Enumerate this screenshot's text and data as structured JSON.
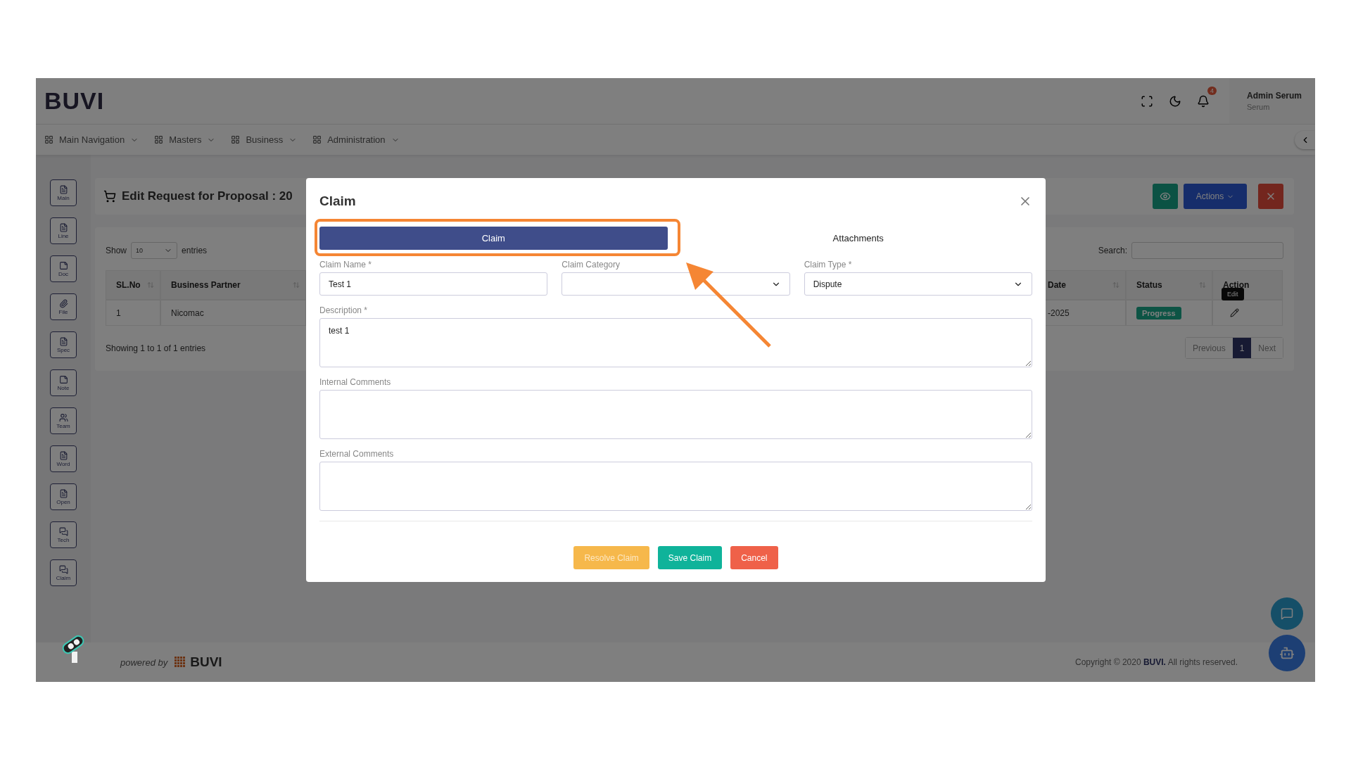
{
  "header": {
    "logo": "BUVI",
    "notification_count": "4",
    "user": {
      "name": "Admin Serum",
      "role": "Serum"
    }
  },
  "nav": [
    {
      "label": "Main Navigation"
    },
    {
      "label": "Masters"
    },
    {
      "label": "Business"
    },
    {
      "label": "Administration"
    }
  ],
  "sidebar": [
    {
      "label": "Main"
    },
    {
      "label": "Line"
    },
    {
      "label": "Doc"
    },
    {
      "label": "File"
    },
    {
      "label": "Spec"
    },
    {
      "label": "Note"
    },
    {
      "label": "Team"
    },
    {
      "label": "Word"
    },
    {
      "label": "Open"
    },
    {
      "label": "Tech"
    },
    {
      "label": "Claim"
    }
  ],
  "page_title": "Edit Request for Proposal : 20",
  "toolbar": {
    "actions_label": "Actions"
  },
  "table_controls": {
    "show_label": "Show",
    "page_size": "10",
    "entries_label": "entries",
    "search_label": "Search:"
  },
  "table": {
    "columns": [
      {
        "label": "SL.No"
      },
      {
        "label": "Business Partner"
      },
      {
        "label": "Date"
      },
      {
        "label": "Status"
      },
      {
        "label": "Action"
      }
    ],
    "rows": [
      {
        "cells": [
          "1",
          "Nicomac",
          "-2025"
        ],
        "status": "Progress",
        "tooltip": "Edit"
      }
    ]
  },
  "table_info": "Showing 1 to 1 of 1 entries",
  "pagination": {
    "previous": "Previous",
    "pages": [
      {
        "label": "1",
        "selected": true
      }
    ],
    "next": "Next"
  },
  "footer": {
    "powered_by": "powered by",
    "brand": "BUVI",
    "copyright": "Copyright © 2020 **BUVI.** All rights reserved."
  },
  "modal": {
    "title": "Claim",
    "tabs": [
      {
        "label": "Claim",
        "selected": true
      },
      {
        "label": "Attachments",
        "selected": false
      }
    ],
    "fields": [
      {
        "label": "Claim Name *",
        "kind": "text",
        "value": "Test 1"
      },
      {
        "label": "Claim Category",
        "kind": "select"
      },
      {
        "label": "Claim Type *",
        "kind": "select",
        "value": "Dispute"
      },
      {
        "label": "Description *",
        "kind": "textarea",
        "value": "test 1"
      },
      {
        "label": "Internal Comments",
        "kind": "textarea"
      },
      {
        "label": "External Comments",
        "kind": "textarea"
      }
    ],
    "buttons": [
      {
        "label": "Resolve Claim",
        "kind": "warning"
      },
      {
        "label": "Save Claim",
        "kind": "success"
      },
      {
        "label": "Cancel",
        "kind": "danger"
      }
    ]
  }
}
